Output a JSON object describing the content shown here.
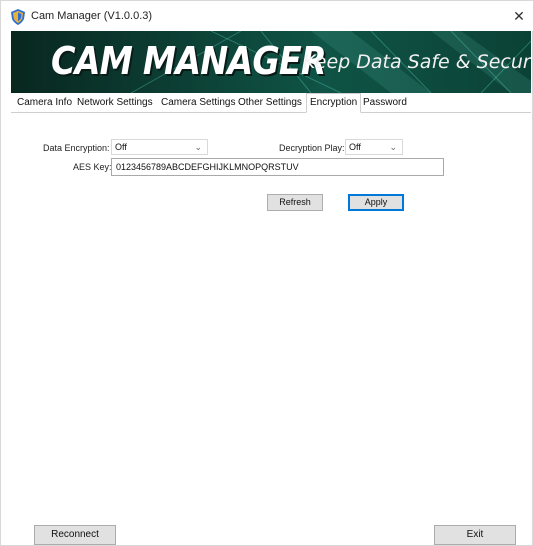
{
  "window": {
    "title": "Cam Manager (V1.0.0.3)",
    "close_glyph": "✕"
  },
  "banner": {
    "logo_text": "CAM MANAGER",
    "tagline": "Keep Data Safe & Secure"
  },
  "tabs": [
    {
      "label": "Camera Info",
      "active": false
    },
    {
      "label": "Network Settings",
      "active": false
    },
    {
      "label": "Camera Settings",
      "active": false
    },
    {
      "label": "Other Settings",
      "active": false
    },
    {
      "label": "Encryption",
      "active": true
    },
    {
      "label": "Password",
      "active": false
    }
  ],
  "encryption": {
    "data_encryption_label": "Data Encryption:",
    "data_encryption_value": "Off",
    "decryption_play_label": "Decryption Play:",
    "decryption_play_value": "Off",
    "aes_key_label": "AES Key:",
    "aes_key_value": "0123456789ABCDEFGHIJKLMNOPQRSTUV",
    "refresh_label": "Refresh",
    "apply_label": "Apply"
  },
  "footer": {
    "reconnect_label": "Reconnect",
    "exit_label": "Exit"
  },
  "icons": {
    "app": "shield-icon",
    "close": "close-icon",
    "dropdown": "chevron-down-icon"
  },
  "colors": {
    "banner_dark": "#08271f",
    "banner_mid": "#0f5446",
    "focus_blue": "#0078d7",
    "app_icon": "#3a7bd5"
  }
}
